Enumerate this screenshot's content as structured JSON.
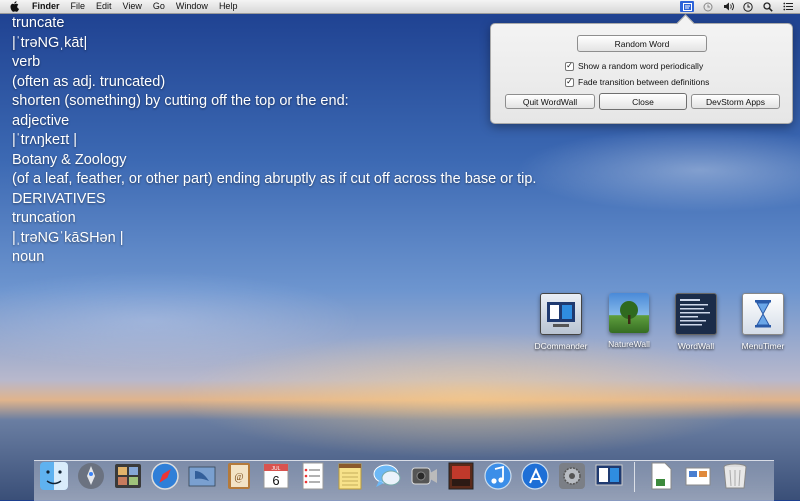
{
  "menubar": {
    "app_name": "Finder",
    "menus": [
      "File",
      "Edit",
      "View",
      "Go",
      "Window",
      "Help"
    ]
  },
  "definition": {
    "lines": [
      "truncate",
      "|ˈtrəNGˌkāt|",
      "verb",
      "(often as adj. truncated)",
      "shorten (something) by cutting off the top or the end:",
      "adjective",
      "|ˈtrʌŋkeɪt |",
      "Botany & Zoology",
      "(of a leaf, feather, or other part) ending abruptly as if cut off across the base or tip.",
      "DERIVATIVES",
      "truncation",
      "|ˌtrəNGˈkāSHən |",
      "noun"
    ]
  },
  "popover": {
    "random_word_label": "Random Word",
    "show_random_label": "Show a random word periodically",
    "show_random_checked": true,
    "fade_transition_label": "Fade transition between definitions",
    "fade_transition_checked": true,
    "quit_label": "Quit WordWall",
    "close_label": "Close",
    "devstorm_label": "DevStorm Apps"
  },
  "desktop_icons": [
    "DCommander",
    "NatureWall",
    "WordWall",
    "MenuTimer"
  ],
  "dock_apps": [
    "finder-icon",
    "launchpad-icon",
    "photo-booth-icon",
    "safari-icon",
    "mail-icon",
    "contacts-icon",
    "calendar-icon",
    "reminders-icon",
    "notes-icon",
    "messages-icon",
    "facetime-icon",
    "photo-frame-icon",
    "itunes-icon",
    "app-store-icon",
    "system-preferences-icon",
    "dcommander-icon",
    "document-icon",
    "stack-icon",
    "trash-icon"
  ],
  "calendar_date": "6",
  "calendar_month": "JUL",
  "colors": {
    "accent": "#2d63d8"
  }
}
